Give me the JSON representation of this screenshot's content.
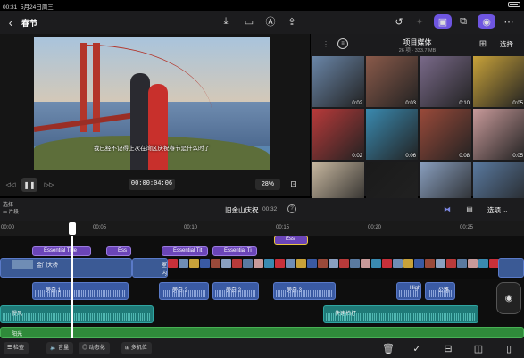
{
  "status": {
    "time": "00:31",
    "date": "5月24日周三",
    "battery": ""
  },
  "topbar": {
    "title": "春节"
  },
  "viewer": {
    "subtitle": "我已经不记得上次在湾区庆祝春节是什么时了",
    "timecode": "00:00:04:06",
    "zoom": "28",
    "zoom_unit": "%"
  },
  "browser": {
    "title": "项目媒体",
    "info": "26 项 · 333.7 MB",
    "select_label": "选择",
    "thumbs": [
      {
        "dur": "0:02",
        "color": "#6a86a8"
      },
      {
        "dur": "0:03",
        "color": "#8a5a4a"
      },
      {
        "dur": "0:10",
        "color": "#7a6a8a"
      },
      {
        "dur": "0:05",
        "color": "#c8a23a"
      },
      {
        "dur": "0:02",
        "color": "#b83a3a"
      },
      {
        "dur": "0:06",
        "color": "#3a8ab0"
      },
      {
        "dur": "0:08",
        "color": "#9a4a3a"
      },
      {
        "dur": "0:05",
        "color": "#c89a9a"
      },
      {
        "dur": "",
        "color": "#c8b8a0"
      },
      {
        "dur": "",
        "color": "#1a1a1a"
      },
      {
        "dur": "",
        "color": "#8aa0c0"
      },
      {
        "dur": "",
        "color": "#5a7aa0"
      }
    ]
  },
  "timeline": {
    "select_top": "选择",
    "select_row": "片段",
    "project_name": "旧金山庆祝",
    "duration": "00:32",
    "options_label": "选项",
    "ruler": [
      "00:00",
      "00:05",
      "00:10",
      "00:15",
      "00:20",
      "00:25"
    ],
    "titles": [
      {
        "label": "Essential Title"
      },
      {
        "label": "Ess"
      },
      {
        "label": "Essential Tit"
      },
      {
        "label": "Essential Ti"
      },
      {
        "label": "Ess"
      }
    ],
    "main_clip": "金门大桥",
    "main_clip2": "室内",
    "voiceovers": [
      {
        "label": "旁白 1"
      },
      {
        "label": "旁白 2"
      },
      {
        "label": "旁白 2"
      },
      {
        "label": "旁白 3"
      },
      {
        "label": "High"
      },
      {
        "label": "公路"
      }
    ],
    "music": [
      {
        "label": "慢风"
      },
      {
        "label": "快速拍打"
      },
      {
        "label": "阳光"
      }
    ]
  },
  "bottombar": {
    "inspect": "检查",
    "volume": "音量",
    "animate": "动态化",
    "multicam": "多机位"
  },
  "colors": {
    "accent": "#6e55e0",
    "title_clip": "#6b45b8",
    "audio": "#3a5aa3",
    "music": "#1f7a78"
  }
}
